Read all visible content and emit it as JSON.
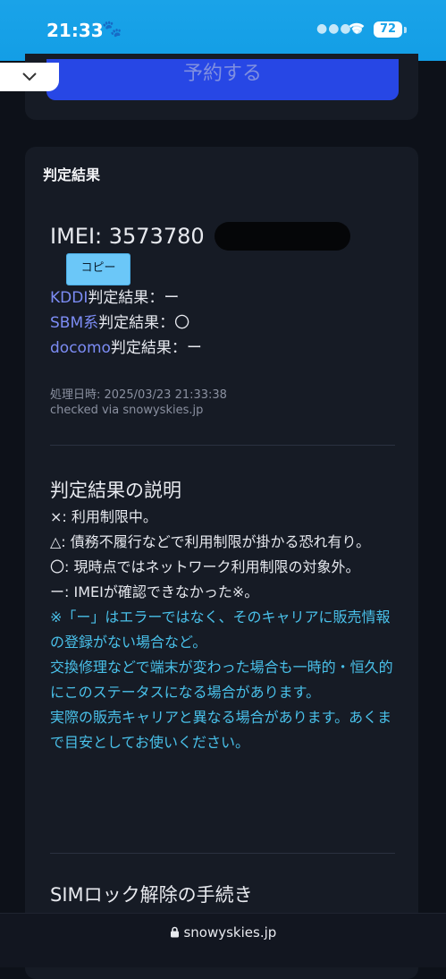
{
  "status": {
    "time": "21:33",
    "battery": "72"
  },
  "top_card": {
    "reserve_label": "予約する"
  },
  "result": {
    "title": "判定結果",
    "imei_text": "IMEI: 3573780",
    "copy_label": "コピー",
    "rows": [
      {
        "carrier": "KDDI",
        "suffix": "判定結果：ー"
      },
      {
        "carrier": "SBM系",
        "suffix": "判定結果：〇"
      },
      {
        "carrier": "docomo",
        "suffix": "判定結果：ー"
      }
    ],
    "processed": "処理日時: 2025/03/23 21:33:38",
    "checked": "checked via snowyskies.jp"
  },
  "explanation": {
    "title": "判定結果の説明",
    "lines": [
      "×: 利用制限中。",
      "△: 債務不履行などで利用制限が掛かる恐れ有り。",
      "〇: 現時点ではネットワーク利用制限の対象外。",
      "ー: IMEIが確認できなかった※。"
    ],
    "notes": [
      "※「ー」はエラーではなく、そのキャリアに販売情報の登録がない場合など。",
      "交換修理などで端末が変わった場合も一時的・恒久的にこのステータスになる場合があります。",
      "実際の販売キャリアと異なる場合があります。あくまで目安としてお使いください。"
    ]
  },
  "sim_unlock": {
    "title": "SIMロック解除の手続き"
  },
  "browser": {
    "url": "snowyskies.jp"
  }
}
